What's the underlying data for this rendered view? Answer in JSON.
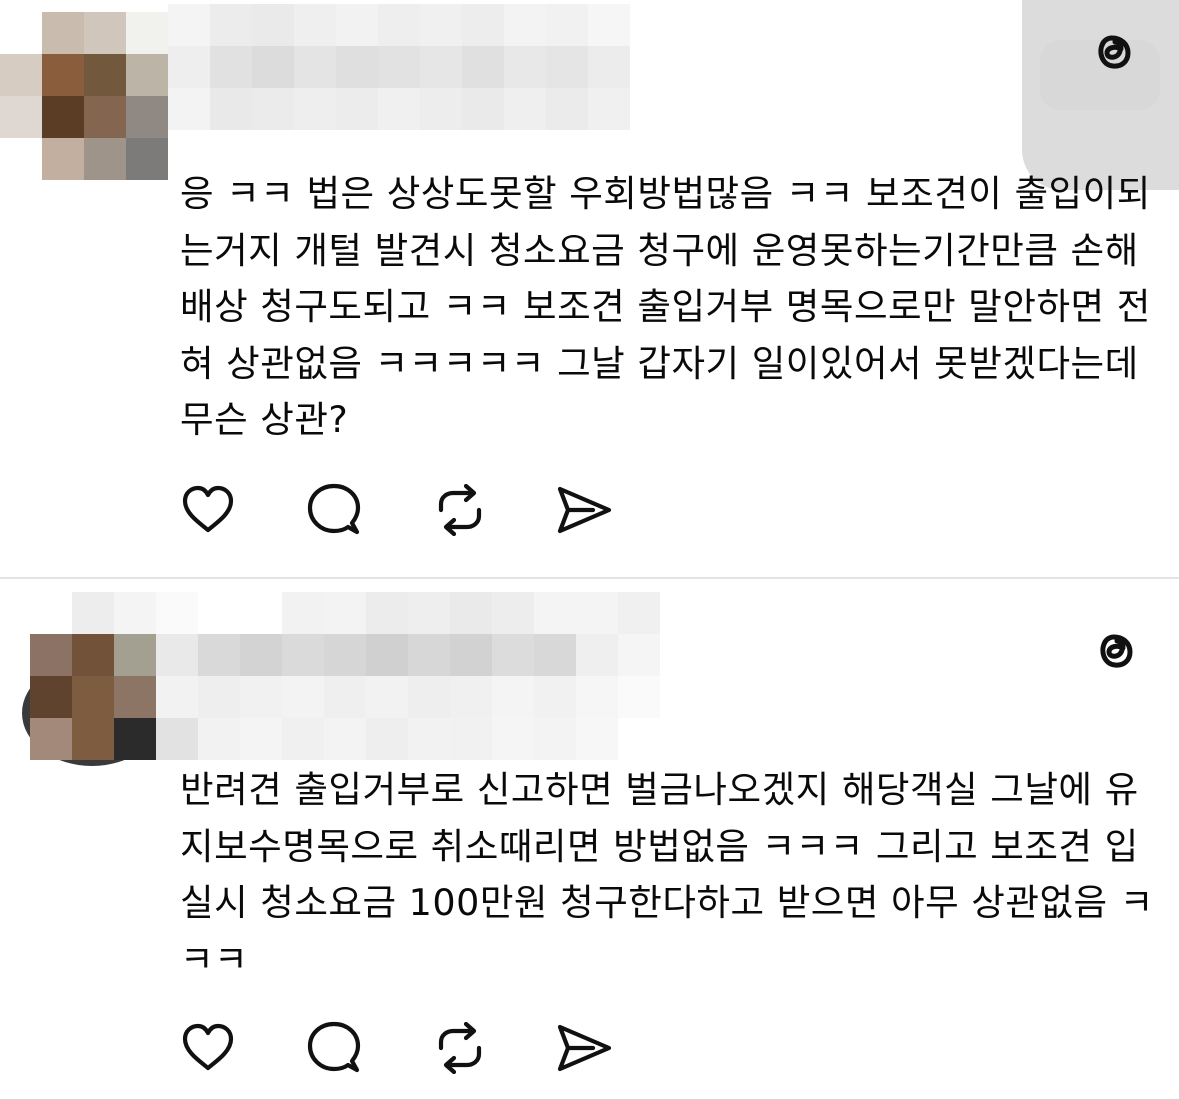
{
  "app": {
    "logo_icon": "threads-logo-icon"
  },
  "posts": [
    {
      "username": "",
      "text_lines": [
        "응 ㅋㅋ 법은 상상도못할 우회방법많음 ㅋㅋ 보조견이 출입이되",
        "는거지 개털 발견시 청소요금 청구에 운영못하는기간만큼 손해",
        "배상 청구도되고 ㅋㅋ 보조견 출입거부 명목으로만 말안하면 전",
        "혀 상관없음 ㅋㅋㅋㅋㅋ 그날 갑자기 일이있어서 못받겠다는데",
        "무슨 상관?"
      ],
      "actions": [
        {
          "name": "like",
          "icon": "heart-icon"
        },
        {
          "name": "reply",
          "icon": "comment-icon"
        },
        {
          "name": "repost",
          "icon": "repost-icon"
        },
        {
          "name": "share",
          "icon": "send-icon"
        }
      ]
    },
    {
      "username": "",
      "text_lines": [
        "반려견 출입거부로 신고하면 벌금나오겠지 해당객실 그날에 유",
        "지보수명목으로 취소때리면 방법없음 ㅋㅋㅋ 그리고 보조견 입",
        "실시 청소요금 100만원 청구한다하고 받으면 아무 상관없음 ㅋ",
        "ㅋㅋ"
      ],
      "actions": [
        {
          "name": "like",
          "icon": "heart-icon"
        },
        {
          "name": "reply",
          "icon": "comment-icon"
        },
        {
          "name": "repost",
          "icon": "repost-icon"
        },
        {
          "name": "share",
          "icon": "send-icon"
        }
      ]
    }
  ],
  "colors": {
    "text": "#0a0a0a",
    "divider": "#e4e4e4",
    "icon_stroke": "#111111",
    "background": "#ffffff"
  }
}
